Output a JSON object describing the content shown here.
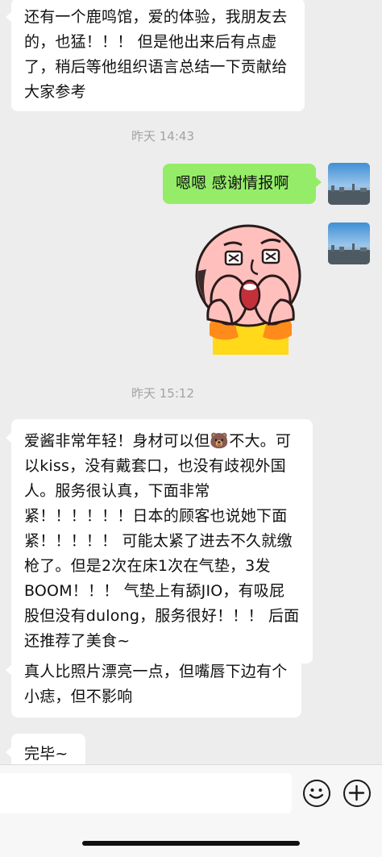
{
  "messages": [
    {
      "side": "left",
      "text": "还有一个鹿鸣馆，爱的体验，我朋友去的，也猛！！！ 但是他出来后有点虚了，稍后等他组织语言总结一下贡献给大家参考"
    },
    {
      "side": "right",
      "text": "嗯嗯 感谢情报啊"
    },
    {
      "side": "left",
      "text": "爱酱非常年轻！身材可以但🐻不大。可以kiss，没有戴套口，也没有歧视外国人。服务很认真，下面非常紧！！！！！！日本的顾客也说她下面紧！！！！！ 可能太紧了进去不久就缴枪了。但是2次在床1次在气垫，3发BOOM！！！ 气垫上有舔JIO，有吸屁股但没有dulong，服务很好！！！ 后面还推荐了美食~"
    },
    {
      "side": "left",
      "text": "真人比照片漂亮一点，但嘴唇下边有个小痣，但不影响"
    },
    {
      "side": "left",
      "text": "完毕~"
    }
  ],
  "timestamps": [
    "昨天 14:43",
    "昨天 15:12"
  ],
  "sticker": "bald-cartoon-face-sticker",
  "input": {
    "placeholder": ""
  },
  "icons": {
    "emoji": "emoji-icon",
    "plus": "plus-icon"
  },
  "colors": {
    "background": "#ededed",
    "self_bubble": "#95ec69",
    "other_bubble": "#ffffff"
  }
}
